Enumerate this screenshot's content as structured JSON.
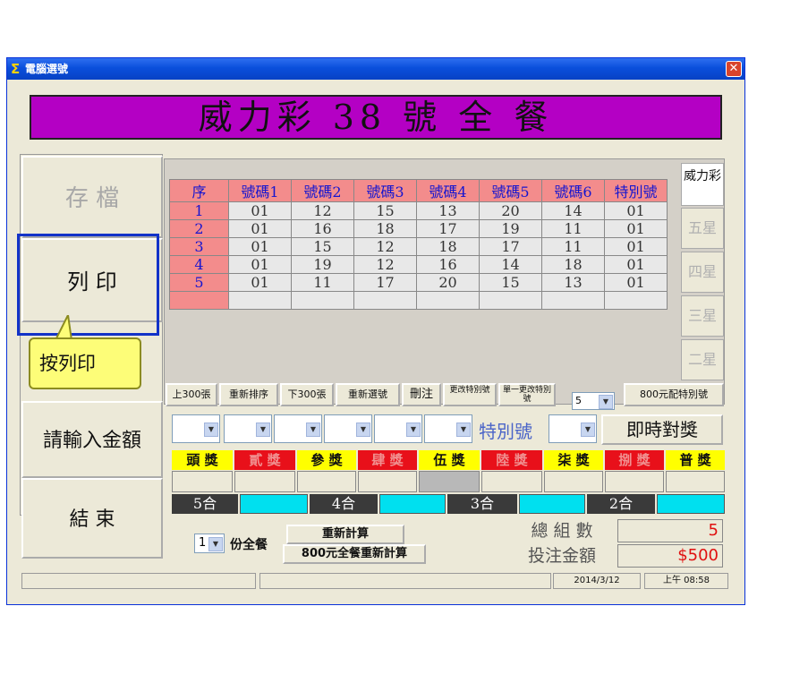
{
  "window": {
    "title": "電腦選號",
    "close": "✕"
  },
  "banner": "威力彩 38 號 全 餐",
  "left_buttons": {
    "save": "存 檔",
    "print": "列 印",
    "amount": "請輸入金額",
    "exit": "結 束"
  },
  "tooltip": "按列印",
  "table": {
    "headers": [
      "序",
      "號碼1",
      "號碼2",
      "號碼3",
      "號碼4",
      "號碼5",
      "號碼6",
      "特別號"
    ],
    "rows": [
      [
        "1",
        "01",
        "12",
        "15",
        "13",
        "20",
        "14",
        "01"
      ],
      [
        "2",
        "01",
        "16",
        "18",
        "17",
        "19",
        "11",
        "01"
      ],
      [
        "3",
        "01",
        "15",
        "12",
        "18",
        "17",
        "11",
        "01"
      ],
      [
        "4",
        "01",
        "19",
        "12",
        "16",
        "14",
        "18",
        "01"
      ],
      [
        "5",
        "01",
        "11",
        "17",
        "20",
        "15",
        "13",
        "01"
      ]
    ]
  },
  "side_tabs": [
    "威力彩",
    "五星",
    "四星",
    "三星",
    "二星"
  ],
  "toolbar": {
    "prev300": "上300張",
    "resort": "重新排序",
    "next300": "下300張",
    "reselect": "重新選號",
    "delete": "刪注",
    "change_special": "更改特別號",
    "single_change": "單一更改特別號",
    "count_value": "5",
    "special800": "800元配特別號"
  },
  "special_label": "特別號",
  "instant_match": "即時對獎",
  "prizes": [
    "頭 獎",
    "貳 獎",
    "參 獎",
    "肆 獎",
    "伍 獎",
    "陸 獎",
    "柒 獎",
    "捌 獎",
    "普 獎"
  ],
  "matches": [
    "5合",
    "4合",
    "3合",
    "2合"
  ],
  "bottom": {
    "copies": "1",
    "copies_label": "份全餐",
    "recalc": "重新計算",
    "recalc800": "800元全餐重新計算",
    "total_groups_label": "總 組 數",
    "total_groups": "5",
    "bet_amount_label": "投注金額",
    "bet_amount": "$500"
  },
  "status": {
    "date": "2014/3/12",
    "time": "上午 08:58"
  },
  "colors": {
    "banner": "#b400c4",
    "header": "#f38c8c",
    "cyan": "#00e0ef",
    "prize_yellow": "#ffff00",
    "prize_red": "#e8101a"
  }
}
